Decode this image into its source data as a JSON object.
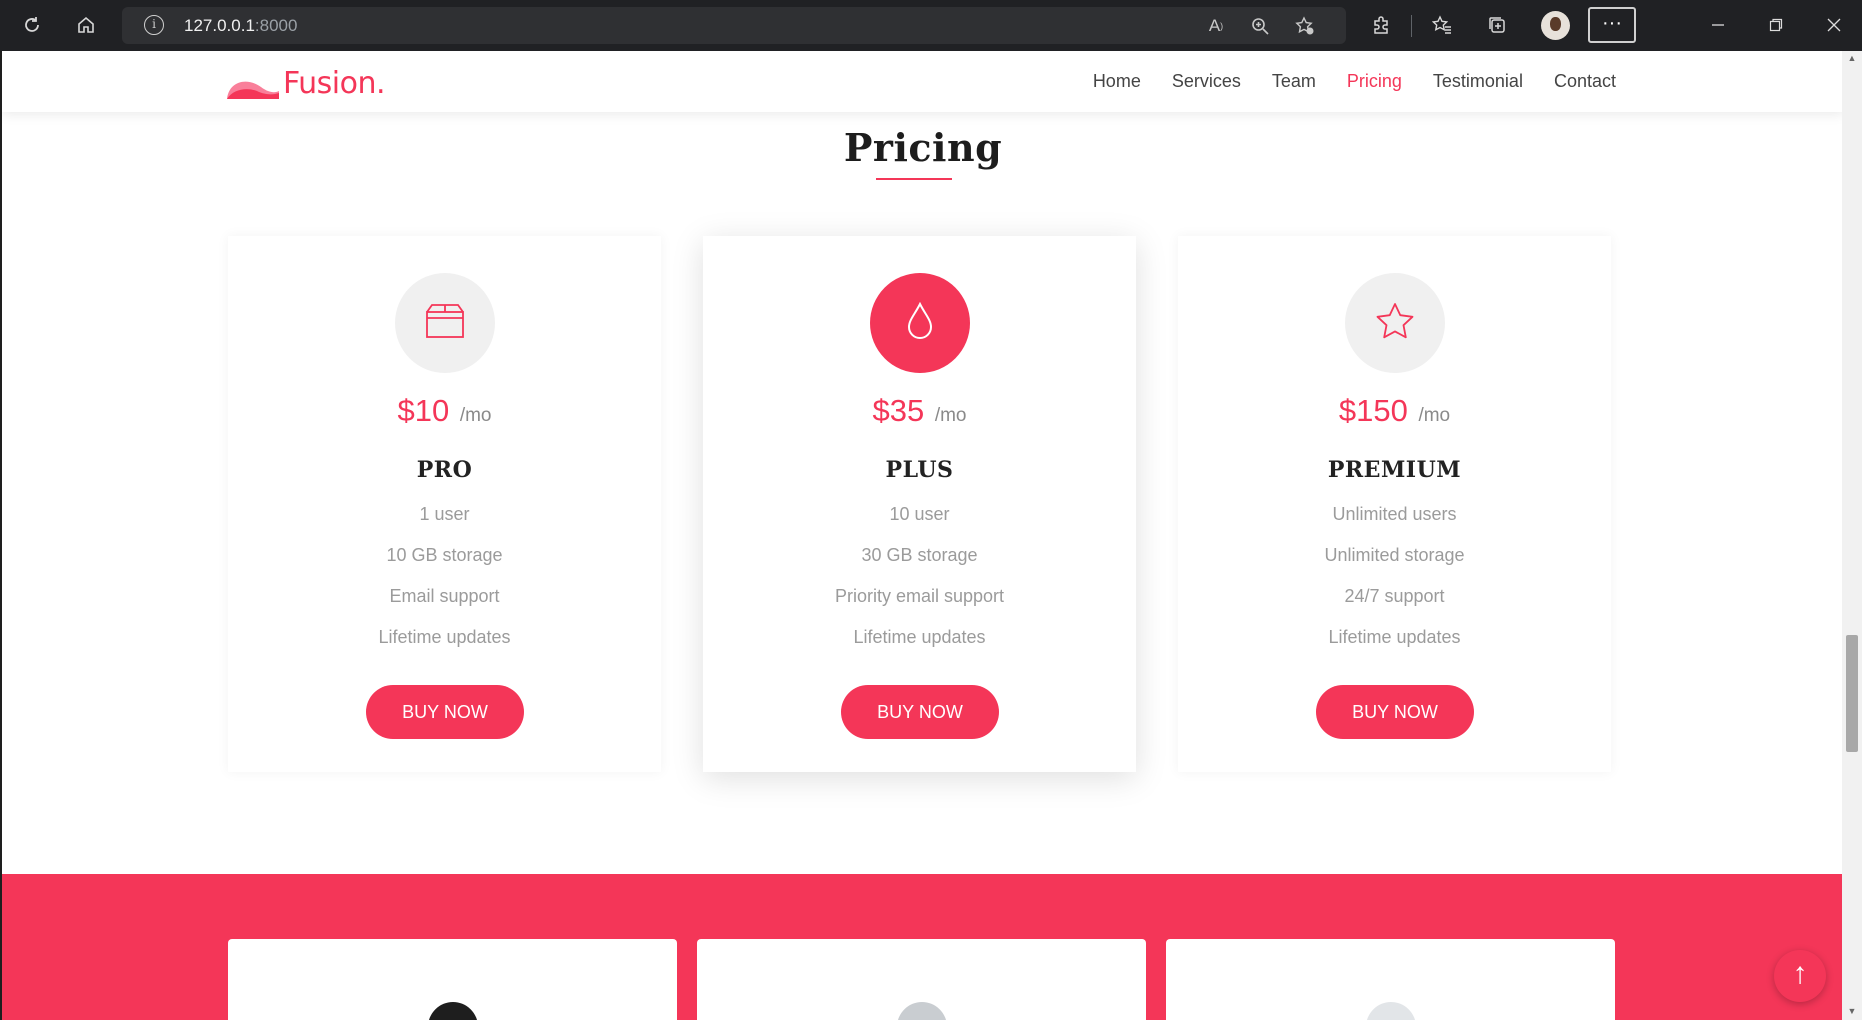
{
  "browser": {
    "url_host": "127.0.0.1",
    "url_port": ":8000"
  },
  "brand": {
    "name": "Fusion.",
    "accent": "#f43658"
  },
  "nav": {
    "items": [
      "Home",
      "Services",
      "Team",
      "Pricing",
      "Testimonial",
      "Contact"
    ],
    "active": "Pricing"
  },
  "section": {
    "title": "Pricing"
  },
  "plans": [
    {
      "icon": "box-icon",
      "price": "$10",
      "period": "/mo",
      "name": "PRO",
      "features": [
        "1 user",
        "10 GB storage",
        "Email support",
        "Lifetime updates"
      ],
      "button": "BUY NOW"
    },
    {
      "icon": "droplet-icon",
      "price": "$35",
      "period": "/mo",
      "name": "PLUS",
      "features": [
        "10 user",
        "30 GB storage",
        "Priority email support",
        "Lifetime updates"
      ],
      "button": "BUY NOW",
      "featured": true
    },
    {
      "icon": "star-icon",
      "price": "$150",
      "period": "/mo",
      "name": "PREMIUM",
      "features": [
        "Unlimited users",
        "Unlimited storage",
        "24/7 support",
        "Lifetime updates"
      ],
      "button": "BUY NOW"
    }
  ]
}
